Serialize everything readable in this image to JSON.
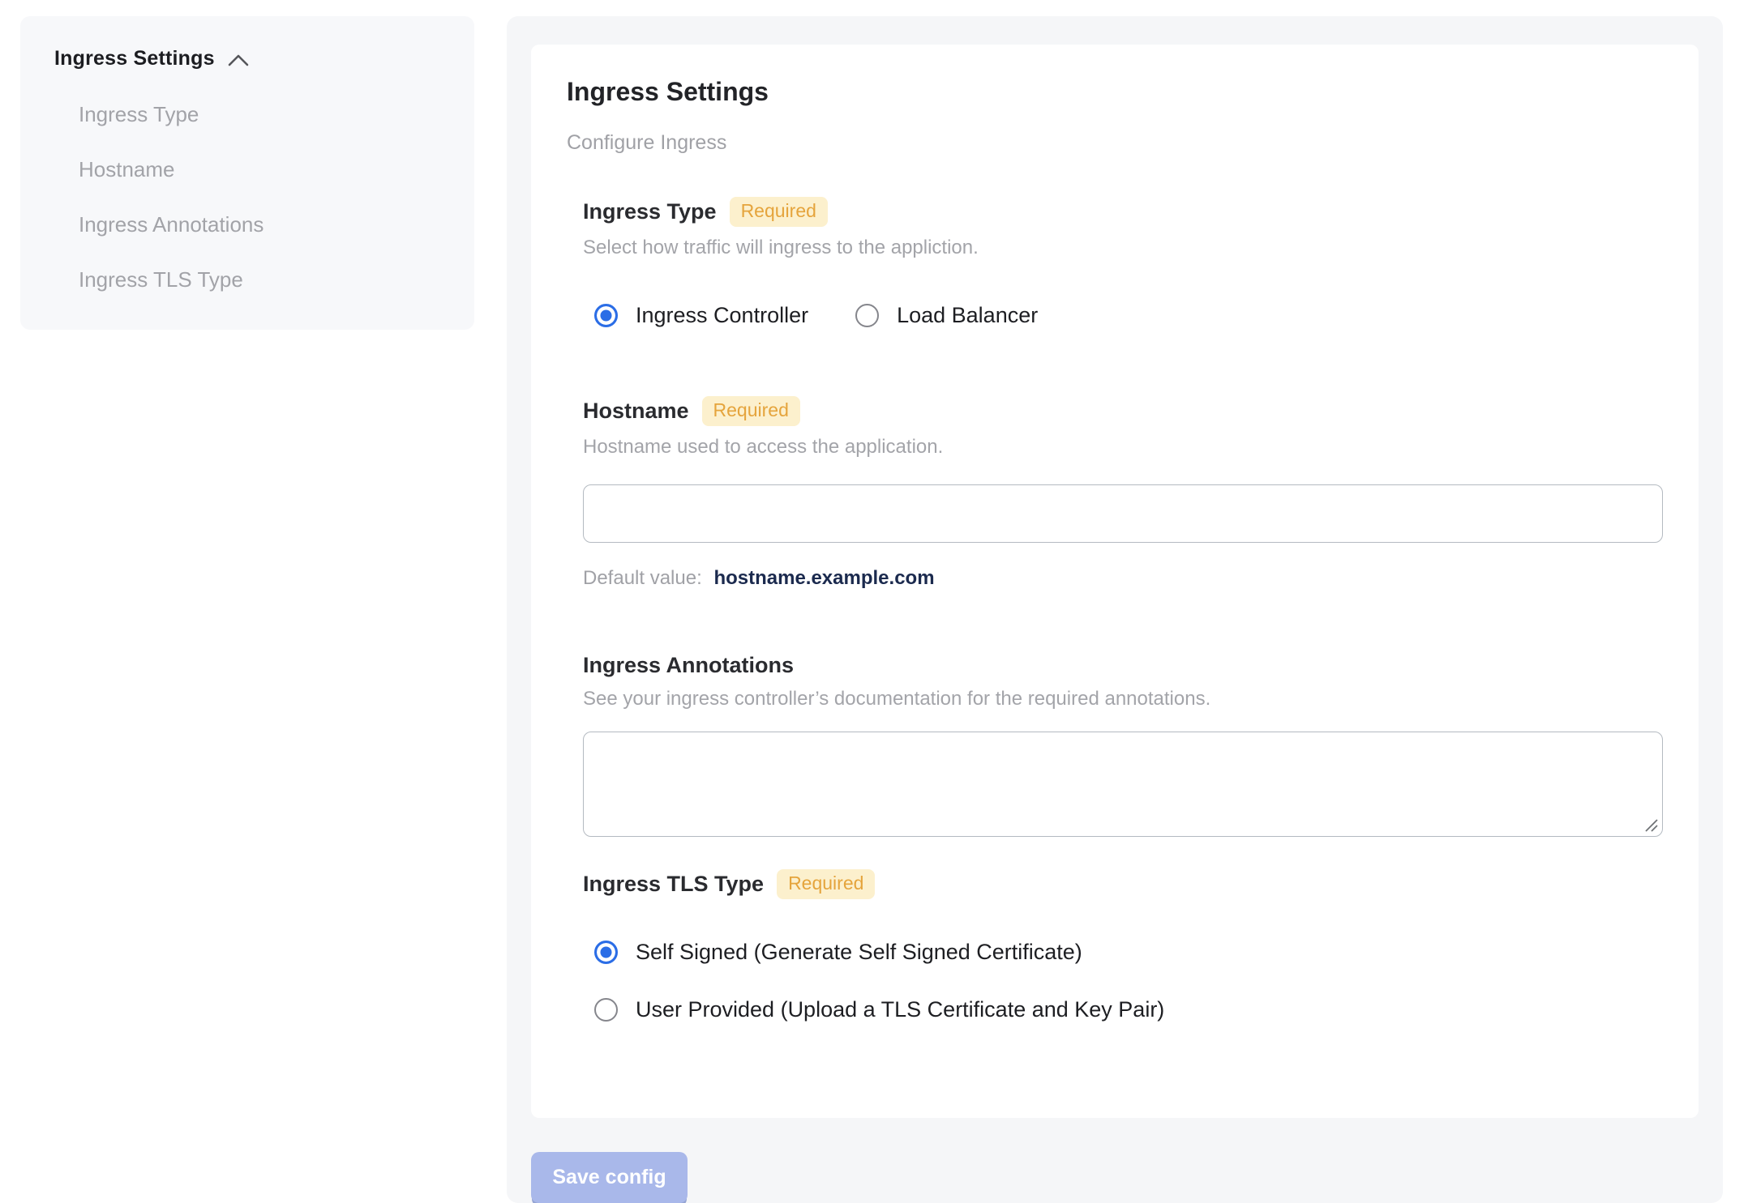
{
  "colors": {
    "accent_blue": "#2b6de6",
    "badge_bg": "#fcf0cd",
    "badge_text": "#e5a43c",
    "save_button_bg": "#a9b8ea",
    "default_value_text": "#1b2a4e",
    "panel_bg": "#f5f6f8",
    "muted_text": "#a3a4a9"
  },
  "sidebar": {
    "title": "Ingress Settings",
    "items": [
      {
        "label": "Ingress Type"
      },
      {
        "label": "Hostname"
      },
      {
        "label": "Ingress Annotations"
      },
      {
        "label": "Ingress TLS Type"
      }
    ]
  },
  "main": {
    "title": "Ingress Settings",
    "subtitle": "Configure Ingress",
    "ingress_type": {
      "label": "Ingress Type",
      "badge": "Required",
      "description": "Select how traffic will ingress to the appliction.",
      "options": [
        {
          "label": "Ingress Controller",
          "selected": true
        },
        {
          "label": "Load Balancer",
          "selected": false
        }
      ]
    },
    "hostname": {
      "label": "Hostname",
      "badge": "Required",
      "description": "Hostname used to access the application.",
      "value": "",
      "default_label": "Default value:",
      "default_value": "hostname.example.com"
    },
    "annotations": {
      "label": "Ingress Annotations",
      "description": "See your ingress controller’s documentation for the required annotations.",
      "value": ""
    },
    "tls": {
      "label": "Ingress TLS Type",
      "badge": "Required",
      "options": [
        {
          "label": "Self Signed (Generate Self Signed Certificate)",
          "selected": true
        },
        {
          "label": "User Provided (Upload a TLS Certificate and Key Pair)",
          "selected": false
        }
      ]
    },
    "save_button": "Save config"
  }
}
